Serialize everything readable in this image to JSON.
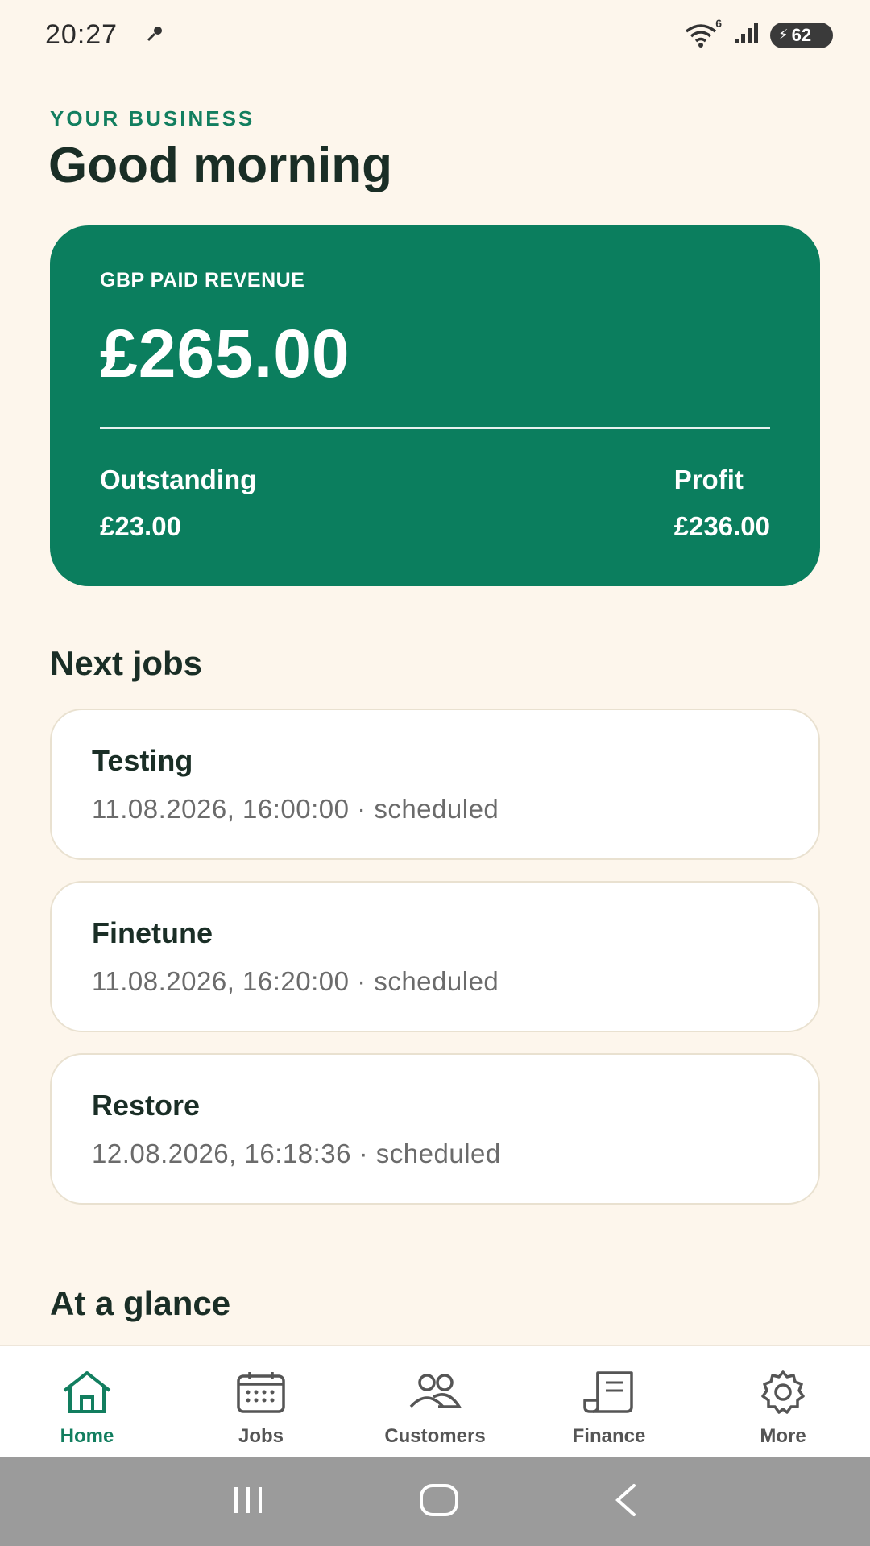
{
  "status": {
    "time": "20:27",
    "battery": "62",
    "wifi_badge": "6",
    "icons": [
      "key-icon",
      "wifi-icon",
      "signal-icon",
      "battery-icon"
    ]
  },
  "header": {
    "eyebrow": "YOUR BUSINESS",
    "greeting": "Good morning"
  },
  "revenue": {
    "label": "GBP PAID REVENUE",
    "amount": "£265.00",
    "outstanding_label": "Outstanding",
    "outstanding_value": "£23.00",
    "profit_label": "Profit",
    "profit_value": "£236.00"
  },
  "next_jobs": {
    "title": "Next jobs",
    "items": [
      {
        "title": "Testing",
        "meta": "11.08.2026, 16:00:00 · scheduled"
      },
      {
        "title": "Finetune",
        "meta": "11.08.2026, 16:20:00 · scheduled"
      },
      {
        "title": "Restore",
        "meta": "12.08.2026, 16:18:36 · scheduled"
      }
    ]
  },
  "glance": {
    "title": "At a glance"
  },
  "nav": {
    "items": [
      {
        "label": "Home",
        "icon": "home-icon",
        "active": true
      },
      {
        "label": "Jobs",
        "icon": "calendar-icon",
        "active": false
      },
      {
        "label": "Customers",
        "icon": "users-icon",
        "active": false
      },
      {
        "label": "Finance",
        "icon": "receipt-icon",
        "active": false
      },
      {
        "label": "More",
        "icon": "gear-icon",
        "active": false
      }
    ]
  },
  "colors": {
    "accent": "#0b7e5e",
    "background": "#fdf6ec",
    "text": "#1a2e26",
    "muted": "#6b6b6b"
  }
}
